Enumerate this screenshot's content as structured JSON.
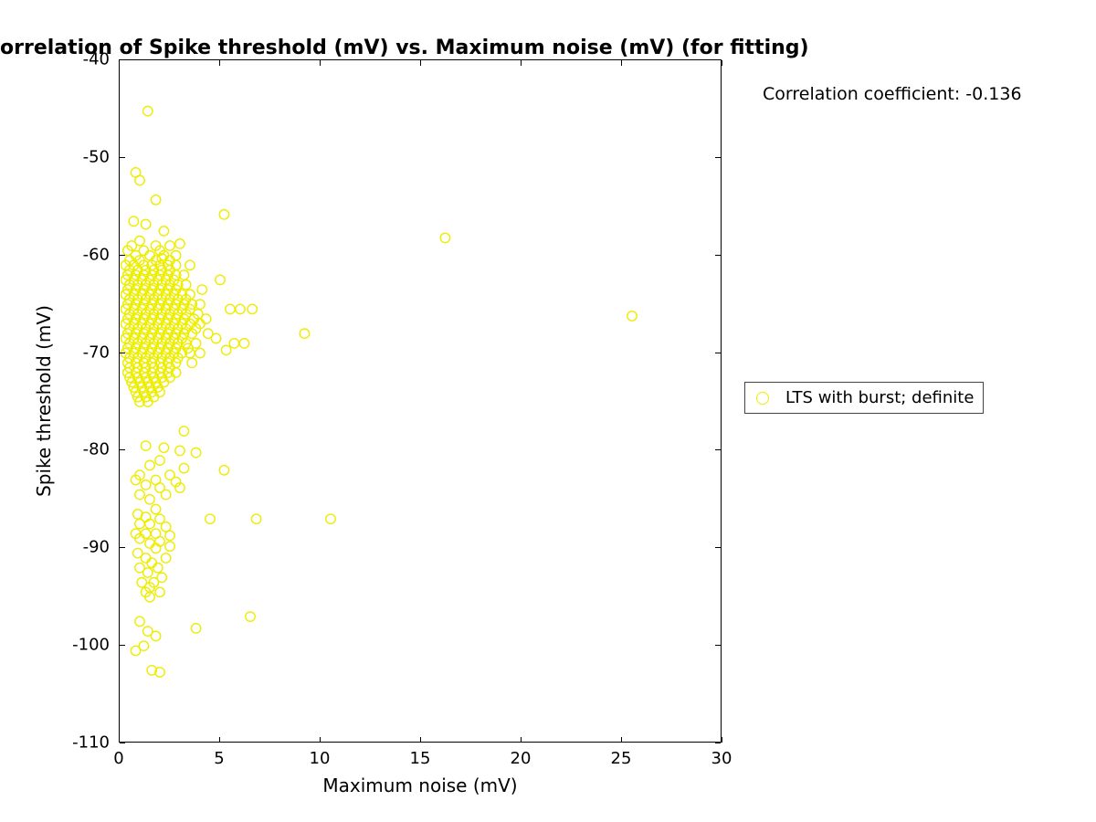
{
  "chart_data": {
    "type": "scatter",
    "title": "orrelation of Spike threshold (mV) vs. Maximum noise (mV) (for fitting)",
    "xlabel": "Maximum noise (mV)",
    "ylabel": "Spike threshold (mV)",
    "xlim": [
      0,
      30
    ],
    "ylim": [
      -110,
      -40
    ],
    "xticks": [
      0,
      5,
      10,
      15,
      20,
      25,
      30
    ],
    "yticks": [
      -110,
      -100,
      -90,
      -80,
      -70,
      -60,
      -50,
      -40
    ],
    "annotation": "Correlation coefficient: -0.136",
    "legend": {
      "items": [
        "LTS with burst; definite"
      ]
    },
    "marker_color": "#eded00",
    "series": [
      {
        "name": "LTS with burst; definite",
        "points": [
          [
            1.4,
            -45.2
          ],
          [
            0.8,
            -51.5
          ],
          [
            1.0,
            -52.3
          ],
          [
            1.8,
            -54.3
          ],
          [
            5.2,
            -55.8
          ],
          [
            0.7,
            -56.5
          ],
          [
            1.3,
            -56.8
          ],
          [
            2.2,
            -57.5
          ],
          [
            16.2,
            -58.2
          ],
          [
            1.0,
            -58.5
          ],
          [
            3.0,
            -58.8
          ],
          [
            0.6,
            -59.0
          ],
          [
            1.8,
            -59.0
          ],
          [
            2.5,
            -59.0
          ],
          [
            0.4,
            -59.5
          ],
          [
            1.2,
            -59.5
          ],
          [
            2.0,
            -59.5
          ],
          [
            0.8,
            -60.0
          ],
          [
            1.5,
            -60.0
          ],
          [
            2.2,
            -60.0
          ],
          [
            2.8,
            -60.0
          ],
          [
            2.1,
            -60.3
          ],
          [
            0.5,
            -60.5
          ],
          [
            1.0,
            -60.5
          ],
          [
            1.8,
            -60.5
          ],
          [
            2.5,
            -60.5
          ],
          [
            0.3,
            -61.0
          ],
          [
            0.7,
            -61.0
          ],
          [
            1.2,
            -61.0
          ],
          [
            1.6,
            -61.0
          ],
          [
            2.0,
            -61.0
          ],
          [
            2.4,
            -61.0
          ],
          [
            2.8,
            -61.0
          ],
          [
            3.5,
            -61.0
          ],
          [
            0.5,
            -61.5
          ],
          [
            0.9,
            -61.5
          ],
          [
            1.3,
            -61.5
          ],
          [
            1.7,
            -61.5
          ],
          [
            2.1,
            -61.5
          ],
          [
            2.5,
            -61.5
          ],
          [
            0.4,
            -62.0
          ],
          [
            0.8,
            -62.0
          ],
          [
            1.2,
            -62.0
          ],
          [
            1.6,
            -62.0
          ],
          [
            2.0,
            -62.0
          ],
          [
            2.4,
            -62.0
          ],
          [
            2.8,
            -62.0
          ],
          [
            3.2,
            -62.0
          ],
          [
            0.3,
            -62.5
          ],
          [
            0.7,
            -62.5
          ],
          [
            1.1,
            -62.5
          ],
          [
            1.5,
            -62.5
          ],
          [
            1.9,
            -62.5
          ],
          [
            2.3,
            -62.5
          ],
          [
            2.7,
            -62.5
          ],
          [
            5.0,
            -62.5
          ],
          [
            0.5,
            -63.0
          ],
          [
            0.9,
            -63.0
          ],
          [
            1.3,
            -63.0
          ],
          [
            1.7,
            -63.0
          ],
          [
            2.1,
            -63.0
          ],
          [
            2.5,
            -63.0
          ],
          [
            2.9,
            -63.0
          ],
          [
            3.3,
            -63.0
          ],
          [
            4.1,
            -63.5
          ],
          [
            0.4,
            -63.5
          ],
          [
            0.8,
            -63.5
          ],
          [
            1.2,
            -63.5
          ],
          [
            1.6,
            -63.5
          ],
          [
            2.0,
            -63.5
          ],
          [
            2.4,
            -63.5
          ],
          [
            2.8,
            -63.5
          ],
          [
            0.3,
            -64.0
          ],
          [
            0.7,
            -64.0
          ],
          [
            1.1,
            -64.0
          ],
          [
            1.5,
            -64.0
          ],
          [
            1.9,
            -64.0
          ],
          [
            2.3,
            -64.0
          ],
          [
            2.7,
            -64.0
          ],
          [
            3.1,
            -64.0
          ],
          [
            3.5,
            -64.0
          ],
          [
            0.5,
            -64.5
          ],
          [
            0.9,
            -64.5
          ],
          [
            1.3,
            -64.5
          ],
          [
            1.7,
            -64.5
          ],
          [
            2.1,
            -64.5
          ],
          [
            2.5,
            -64.5
          ],
          [
            2.9,
            -64.5
          ],
          [
            3.3,
            -64.5
          ],
          [
            0.4,
            -65.0
          ],
          [
            0.8,
            -65.0
          ],
          [
            1.2,
            -65.0
          ],
          [
            1.6,
            -65.0
          ],
          [
            2.0,
            -65.0
          ],
          [
            2.4,
            -65.0
          ],
          [
            2.8,
            -65.0
          ],
          [
            3.2,
            -65.0
          ],
          [
            3.6,
            -65.0
          ],
          [
            4.0,
            -65.0
          ],
          [
            0.3,
            -65.5
          ],
          [
            0.7,
            -65.5
          ],
          [
            1.1,
            -65.5
          ],
          [
            1.5,
            -65.5
          ],
          [
            1.9,
            -65.5
          ],
          [
            2.3,
            -65.5
          ],
          [
            2.7,
            -65.5
          ],
          [
            3.1,
            -65.5
          ],
          [
            3.5,
            -65.5
          ],
          [
            5.5,
            -65.5
          ],
          [
            6.0,
            -65.5
          ],
          [
            6.6,
            -65.5
          ],
          [
            0.5,
            -66.0
          ],
          [
            0.9,
            -66.0
          ],
          [
            1.3,
            -66.0
          ],
          [
            1.7,
            -66.0
          ],
          [
            2.1,
            -66.0
          ],
          [
            2.5,
            -66.0
          ],
          [
            2.9,
            -66.0
          ],
          [
            3.3,
            -66.0
          ],
          [
            3.9,
            -66.0
          ],
          [
            25.5,
            -66.2
          ],
          [
            0.4,
            -66.5
          ],
          [
            0.8,
            -66.5
          ],
          [
            1.2,
            -66.5
          ],
          [
            1.6,
            -66.5
          ],
          [
            2.0,
            -66.5
          ],
          [
            2.4,
            -66.5
          ],
          [
            2.8,
            -66.5
          ],
          [
            3.2,
            -66.5
          ],
          [
            3.7,
            -66.5
          ],
          [
            4.3,
            -66.5
          ],
          [
            0.3,
            -67.0
          ],
          [
            0.7,
            -67.0
          ],
          [
            1.1,
            -67.0
          ],
          [
            1.5,
            -67.0
          ],
          [
            1.9,
            -67.0
          ],
          [
            2.3,
            -67.0
          ],
          [
            2.7,
            -67.0
          ],
          [
            3.1,
            -67.0
          ],
          [
            3.5,
            -67.0
          ],
          [
            4.0,
            -67.0
          ],
          [
            0.5,
            -67.5
          ],
          [
            0.9,
            -67.5
          ],
          [
            1.3,
            -67.5
          ],
          [
            1.7,
            -67.5
          ],
          [
            2.1,
            -67.5
          ],
          [
            2.5,
            -67.5
          ],
          [
            2.9,
            -67.5
          ],
          [
            3.3,
            -67.5
          ],
          [
            3.8,
            -67.5
          ],
          [
            0.4,
            -68.0
          ],
          [
            0.8,
            -68.0
          ],
          [
            1.2,
            -68.0
          ],
          [
            1.6,
            -68.0
          ],
          [
            2.0,
            -68.0
          ],
          [
            2.4,
            -68.0
          ],
          [
            2.8,
            -68.0
          ],
          [
            3.2,
            -68.0
          ],
          [
            3.6,
            -68.0
          ],
          [
            4.4,
            -68.0
          ],
          [
            9.2,
            -68.0
          ],
          [
            0.3,
            -68.5
          ],
          [
            0.7,
            -68.5
          ],
          [
            1.1,
            -68.5
          ],
          [
            1.5,
            -68.5
          ],
          [
            1.9,
            -68.5
          ],
          [
            2.3,
            -68.5
          ],
          [
            2.7,
            -68.5
          ],
          [
            3.1,
            -68.5
          ],
          [
            4.8,
            -68.5
          ],
          [
            0.5,
            -69.0
          ],
          [
            0.9,
            -69.0
          ],
          [
            1.3,
            -69.0
          ],
          [
            1.7,
            -69.0
          ],
          [
            2.1,
            -69.0
          ],
          [
            2.5,
            -69.0
          ],
          [
            2.9,
            -69.0
          ],
          [
            3.3,
            -69.0
          ],
          [
            3.8,
            -69.0
          ],
          [
            5.7,
            -69.0
          ],
          [
            6.2,
            -69.0
          ],
          [
            0.4,
            -69.5
          ],
          [
            0.8,
            -69.5
          ],
          [
            1.2,
            -69.5
          ],
          [
            1.6,
            -69.5
          ],
          [
            2.0,
            -69.5
          ],
          [
            2.4,
            -69.5
          ],
          [
            2.8,
            -69.5
          ],
          [
            3.4,
            -69.5
          ],
          [
            5.3,
            -69.7
          ],
          [
            0.3,
            -70.0
          ],
          [
            0.7,
            -70.0
          ],
          [
            1.1,
            -70.0
          ],
          [
            1.5,
            -70.0
          ],
          [
            1.9,
            -70.0
          ],
          [
            2.3,
            -70.0
          ],
          [
            2.7,
            -70.0
          ],
          [
            3.1,
            -70.0
          ],
          [
            3.5,
            -70.0
          ],
          [
            4.0,
            -70.0
          ],
          [
            0.5,
            -70.5
          ],
          [
            0.9,
            -70.5
          ],
          [
            1.3,
            -70.5
          ],
          [
            1.7,
            -70.5
          ],
          [
            2.1,
            -70.5
          ],
          [
            2.5,
            -70.5
          ],
          [
            2.9,
            -70.5
          ],
          [
            0.4,
            -71.0
          ],
          [
            0.8,
            -71.0
          ],
          [
            1.2,
            -71.0
          ],
          [
            1.6,
            -71.0
          ],
          [
            2.0,
            -71.0
          ],
          [
            2.4,
            -71.0
          ],
          [
            2.8,
            -71.0
          ],
          [
            3.6,
            -71.0
          ],
          [
            0.5,
            -71.5
          ],
          [
            0.9,
            -71.5
          ],
          [
            1.3,
            -71.5
          ],
          [
            1.7,
            -71.5
          ],
          [
            2.1,
            -71.5
          ],
          [
            2.5,
            -71.5
          ],
          [
            0.4,
            -72.0
          ],
          [
            0.8,
            -72.0
          ],
          [
            1.2,
            -72.0
          ],
          [
            1.6,
            -72.0
          ],
          [
            2.0,
            -72.0
          ],
          [
            2.4,
            -72.0
          ],
          [
            2.8,
            -72.0
          ],
          [
            0.5,
            -72.5
          ],
          [
            0.9,
            -72.5
          ],
          [
            1.3,
            -72.5
          ],
          [
            1.7,
            -72.5
          ],
          [
            2.1,
            -72.5
          ],
          [
            2.5,
            -72.5
          ],
          [
            0.6,
            -73.0
          ],
          [
            1.0,
            -73.0
          ],
          [
            1.4,
            -73.0
          ],
          [
            1.8,
            -73.0
          ],
          [
            2.2,
            -73.0
          ],
          [
            0.7,
            -73.5
          ],
          [
            1.1,
            -73.5
          ],
          [
            1.5,
            -73.5
          ],
          [
            1.9,
            -73.5
          ],
          [
            0.8,
            -74.0
          ],
          [
            1.2,
            -74.0
          ],
          [
            1.6,
            -74.0
          ],
          [
            2.0,
            -74.0
          ],
          [
            0.9,
            -74.5
          ],
          [
            1.3,
            -74.5
          ],
          [
            1.7,
            -74.5
          ],
          [
            1.0,
            -75.0
          ],
          [
            1.4,
            -75.0
          ],
          [
            3.2,
            -78.0
          ],
          [
            1.3,
            -79.5
          ],
          [
            2.2,
            -79.7
          ],
          [
            3.0,
            -80.0
          ],
          [
            3.8,
            -80.2
          ],
          [
            2.0,
            -81.0
          ],
          [
            1.5,
            -81.5
          ],
          [
            3.2,
            -81.8
          ],
          [
            5.2,
            -82.0
          ],
          [
            1.0,
            -82.5
          ],
          [
            2.5,
            -82.5
          ],
          [
            0.8,
            -83.0
          ],
          [
            1.8,
            -83.0
          ],
          [
            2.8,
            -83.2
          ],
          [
            1.3,
            -83.5
          ],
          [
            2.0,
            -83.8
          ],
          [
            3.0,
            -83.8
          ],
          [
            1.0,
            -84.5
          ],
          [
            2.3,
            -84.5
          ],
          [
            1.5,
            -85.0
          ],
          [
            1.8,
            -86.0
          ],
          [
            0.9,
            -86.5
          ],
          [
            1.3,
            -86.8
          ],
          [
            2.0,
            -87.0
          ],
          [
            4.5,
            -87.0
          ],
          [
            6.8,
            -87.0
          ],
          [
            10.5,
            -87.0
          ],
          [
            1.0,
            -87.5
          ],
          [
            1.5,
            -87.5
          ],
          [
            2.3,
            -87.8
          ],
          [
            0.8,
            -88.5
          ],
          [
            1.3,
            -88.5
          ],
          [
            1.8,
            -88.5
          ],
          [
            2.5,
            -88.7
          ],
          [
            1.0,
            -89.0
          ],
          [
            2.0,
            -89.3
          ],
          [
            1.5,
            -89.5
          ],
          [
            2.5,
            -89.8
          ],
          [
            1.8,
            -90.0
          ],
          [
            0.9,
            -90.5
          ],
          [
            1.3,
            -91.0
          ],
          [
            2.3,
            -91.0
          ],
          [
            1.6,
            -91.5
          ],
          [
            1.0,
            -92.0
          ],
          [
            1.9,
            -92.0
          ],
          [
            1.4,
            -92.5
          ],
          [
            2.1,
            -93.0
          ],
          [
            1.1,
            -93.5
          ],
          [
            1.7,
            -93.5
          ],
          [
            1.5,
            -94.0
          ],
          [
            2.0,
            -94.5
          ],
          [
            1.3,
            -94.5
          ],
          [
            1.5,
            -95.0
          ],
          [
            6.5,
            -97.0
          ],
          [
            1.0,
            -97.5
          ],
          [
            3.8,
            -98.2
          ],
          [
            1.4,
            -98.5
          ],
          [
            1.8,
            -99.0
          ],
          [
            1.2,
            -100.0
          ],
          [
            0.8,
            -100.5
          ],
          [
            1.6,
            -102.5
          ],
          [
            2.0,
            -102.7
          ]
        ]
      }
    ]
  }
}
